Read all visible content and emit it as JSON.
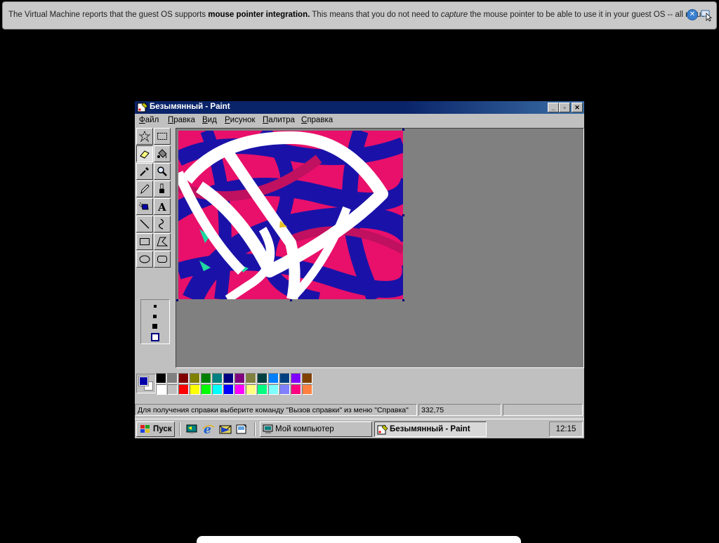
{
  "notification": {
    "text_prefix": "The Virtual Machine reports that the guest OS supports ",
    "text_bold": "mouse pointer integration.",
    "text_middle": " This means that you do not need to ",
    "text_italic": "capture",
    "text_suffix": " the mouse pointer to be able to use it in your guest OS -- all mouse",
    "close_icon": "close-icon",
    "mouse_icon": "mouse-integration-icon"
  },
  "window": {
    "title": "Безымянный - Paint",
    "buttons": {
      "minimize": "_",
      "restore": "▫",
      "close": "✕"
    }
  },
  "menu": [
    "Файл",
    "Правка",
    "Вид",
    "Рисунок",
    "Палитра",
    "Справка"
  ],
  "tools": [
    {
      "name": "free-select",
      "icon": "star-select-icon"
    },
    {
      "name": "rect-select",
      "icon": "rect-select-icon"
    },
    {
      "name": "eraser",
      "icon": "eraser-icon",
      "active": true
    },
    {
      "name": "fill",
      "icon": "paint-bucket-icon"
    },
    {
      "name": "pick-color",
      "icon": "eyedropper-icon"
    },
    {
      "name": "magnifier",
      "icon": "magnifier-icon"
    },
    {
      "name": "pencil",
      "icon": "pencil-icon"
    },
    {
      "name": "brush",
      "icon": "brush-icon"
    },
    {
      "name": "airbrush",
      "icon": "airbrush-icon"
    },
    {
      "name": "text",
      "icon": "text-icon"
    },
    {
      "name": "line",
      "icon": "line-icon"
    },
    {
      "name": "curve",
      "icon": "curve-icon"
    },
    {
      "name": "rectangle",
      "icon": "rectangle-icon"
    },
    {
      "name": "polygon",
      "icon": "polygon-icon"
    },
    {
      "name": "ellipse",
      "icon": "ellipse-icon"
    },
    {
      "name": "rounded-rect",
      "icon": "rounded-rect-icon"
    }
  ],
  "colors": {
    "foreground": "#0000a8",
    "background": "#ffffff",
    "palette_top": [
      "#000000",
      "#808080",
      "#800000",
      "#808000",
      "#008000",
      "#008080",
      "#000080",
      "#800080",
      "#808040",
      "#004040",
      "#0080ff",
      "#004080",
      "#8000ff",
      "#804000"
    ],
    "palette_bottom": [
      "#ffffff",
      "#c0c0c0",
      "#ff0000",
      "#ffff00",
      "#00ff00",
      "#00ffff",
      "#0000ff",
      "#ff00ff",
      "#ffff80",
      "#00ff80",
      "#80ffff",
      "#8080ff",
      "#ff0080",
      "#ff8040"
    ]
  },
  "status": {
    "help": "Для получения справки выберите команду \"Вызов справки\" из меню \"Справка\"",
    "coords": "332,75",
    "size": ""
  },
  "taskbar": {
    "start": "Пуск",
    "quick_launch": [
      "show-desktop-icon",
      "internet-explorer-icon",
      "outlook-express-icon",
      "channels-icon"
    ],
    "tasks": [
      {
        "label": "Мой компьютер",
        "icon": "my-computer-icon",
        "pressed": false
      },
      {
        "label": "Безымянный - Paint",
        "icon": "paint-icon",
        "pressed": true
      }
    ],
    "clock": "12:15"
  }
}
